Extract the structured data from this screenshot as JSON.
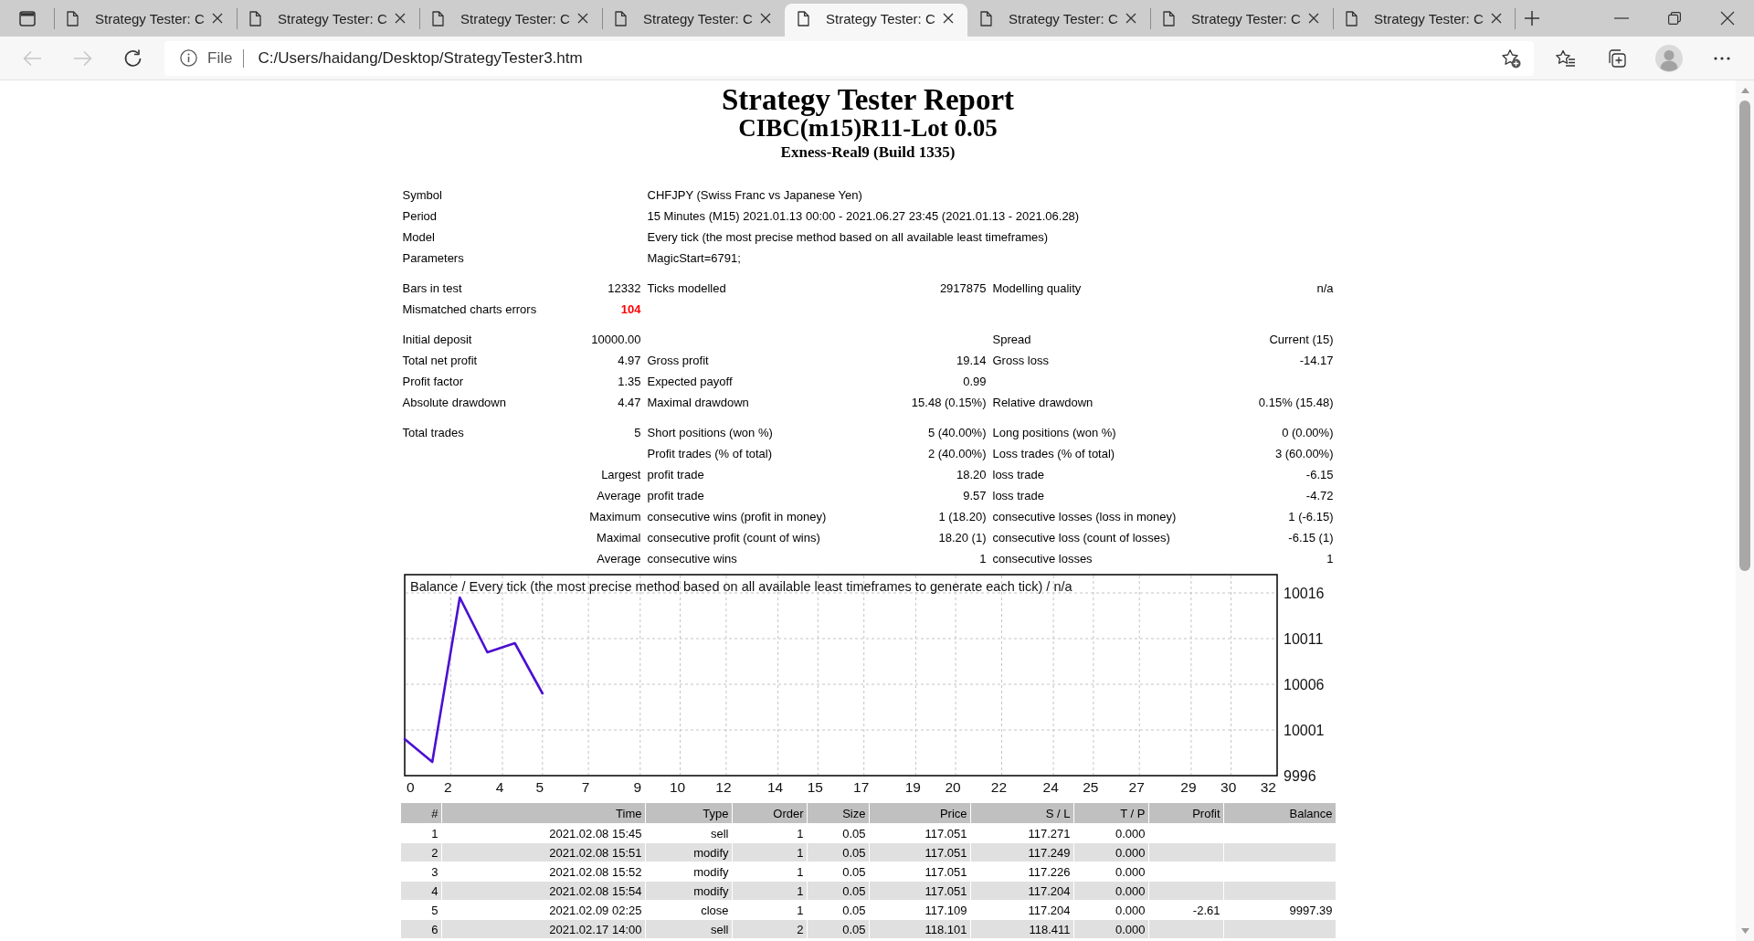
{
  "browser": {
    "tabs": [
      {
        "title": "Strategy Tester: C",
        "selected": false
      },
      {
        "title": "Strategy Tester: C",
        "selected": false
      },
      {
        "title": "Strategy Tester: C",
        "selected": false
      },
      {
        "title": "Strategy Tester: C",
        "selected": false
      },
      {
        "title": "Strategy Tester: C",
        "selected": true
      },
      {
        "title": "Strategy Tester: C",
        "selected": false
      },
      {
        "title": "Strategy Tester: C",
        "selected": false
      },
      {
        "title": "Strategy Tester: C",
        "selected": false
      }
    ],
    "nav_buttons": [
      {
        "kind": "back",
        "disabled": true
      },
      {
        "kind": "forward",
        "disabled": true
      },
      {
        "kind": "refresh",
        "disabled": false
      }
    ],
    "address": {
      "scheme": "File",
      "url": "C:/Users/haidang/Desktop/StrategyTester3.htm"
    }
  },
  "report": {
    "title": "Strategy Tester Report",
    "subtitle": "CIBC(m15)R11-Lot 0.05",
    "server": "Exness-Real9 (Build 1335)"
  },
  "summary": [
    {
      "rows": [
        {
          "kind": "info",
          "cells": [
            "Symbol",
            "CHFJPY (Swiss Franc vs Japanese Yen)"
          ]
        },
        {
          "kind": "info",
          "cells": [
            "Period",
            "15 Minutes (M15) 2021.01.13 00:00 - 2021.06.27 23:45 (2021.01.13 - 2021.06.28)"
          ]
        },
        {
          "kind": "info",
          "cells": [
            "Model",
            "Every tick (the most precise method based on all available least timeframes)"
          ]
        },
        {
          "kind": "info",
          "cells": [
            "Parameters",
            "MagicStart=6791;"
          ]
        }
      ]
    },
    {
      "rows": [
        {
          "kind": "stats",
          "cells": [
            "Bars in test",
            "12332",
            "Ticks modelled",
            "2917875",
            "Modelling quality",
            "n/a"
          ]
        },
        {
          "kind": "alert",
          "cells": [
            "Mismatched charts errors",
            "104"
          ]
        }
      ]
    },
    {
      "rows": [
        {
          "kind": "stats",
          "cells": [
            "Initial deposit",
            "10000.00",
            null,
            null,
            "Spread",
            "Current (15)"
          ]
        },
        {
          "kind": "stats",
          "cells": [
            "Total net profit",
            "4.97",
            "Gross profit",
            "19.14",
            "Gross loss",
            "-14.17"
          ]
        },
        {
          "kind": "stats",
          "cells": [
            "Profit factor",
            "1.35",
            "Expected payoff",
            "0.99",
            null,
            null
          ]
        },
        {
          "kind": "stats",
          "cells": [
            "Absolute drawdown",
            "4.47",
            "Maximal drawdown",
            "15.48 (0.15%)",
            "Relative drawdown",
            "0.15% (15.48)"
          ]
        }
      ]
    },
    {
      "rows": [
        {
          "kind": "stats",
          "cells": [
            "Total trades",
            "5",
            "Short positions (won %)",
            "5 (40.00%)",
            "Long positions (won %)",
            "0 (0.00%)"
          ]
        },
        {
          "kind": "stats",
          "cells": [
            null,
            null,
            "Profit trades (% of total)",
            "2 (40.00%)",
            "Loss trades (% of total)",
            "3 (60.00%)"
          ]
        },
        {
          "kind": "stats",
          "cells": [
            null,
            "Largest",
            "profit trade",
            "18.20",
            "loss trade",
            "-6.15"
          ]
        },
        {
          "kind": "stats",
          "cells": [
            null,
            "Average",
            "profit trade",
            "9.57",
            "loss trade",
            "-4.72"
          ]
        },
        {
          "kind": "stats",
          "cells": [
            null,
            "Maximum",
            "consecutive wins (profit in money)",
            "1 (18.20)",
            "consecutive losses (loss in money)",
            "1 (-6.15)"
          ]
        },
        {
          "kind": "stats",
          "cells": [
            null,
            "Maximal",
            "consecutive profit (count of wins)",
            "18.20 (1)",
            "consecutive loss (count of losses)",
            "-6.15 (1)"
          ]
        },
        {
          "kind": "stats",
          "cells": [
            null,
            "Average",
            "consecutive wins",
            "1",
            "consecutive losses",
            "1"
          ]
        }
      ]
    }
  ],
  "balance_chart": {
    "chart_data": {
      "type": "line",
      "title": "Balance / Every tick (the most precise method based on all available least timeframes to generate each tick) / n/a",
      "x": [
        0,
        1,
        2,
        3,
        4,
        5
      ],
      "values": [
        10000,
        9997.5,
        10015.5,
        10009.5,
        10010.5,
        10005
      ],
      "color": "#4b10d0",
      "xlim": [
        0,
        31.67
      ],
      "ylim": [
        9996,
        10018
      ],
      "xticks": [
        {
          "value": 0,
          "label": "0"
        },
        {
          "value": 1.67,
          "label": "2"
        },
        {
          "value": 3.55,
          "label": "4"
        },
        {
          "value": 5,
          "label": "5"
        },
        {
          "value": 6.67,
          "label": "7"
        },
        {
          "value": 8.55,
          "label": "9"
        },
        {
          "value": 10,
          "label": "10"
        },
        {
          "value": 11.67,
          "label": "12"
        },
        {
          "value": 13.55,
          "label": "14"
        },
        {
          "value": 15,
          "label": "15"
        },
        {
          "value": 16.67,
          "label": "17"
        },
        {
          "value": 18.55,
          "label": "19"
        },
        {
          "value": 20,
          "label": "20"
        },
        {
          "value": 21.67,
          "label": "22"
        },
        {
          "value": 23.55,
          "label": "24"
        },
        {
          "value": 25,
          "label": "25"
        },
        {
          "value": 26.67,
          "label": "27"
        },
        {
          "value": 28.55,
          "label": "29"
        },
        {
          "value": 30,
          "label": "30"
        },
        {
          "value": 31.67,
          "label": "32"
        }
      ],
      "yticks": [
        9996,
        10001,
        10006,
        10011,
        10016
      ],
      "grid": true
    }
  },
  "trades": {
    "columns": [
      "#",
      "Time",
      "Type",
      "Order",
      "Size",
      "Price",
      "S / L",
      "T / P",
      "Profit",
      "Balance"
    ],
    "rows": [
      [
        "1",
        "2021.02.08 15:45",
        "sell",
        "1",
        "0.05",
        "117.051",
        "117.271",
        "0.000",
        null,
        null
      ],
      [
        "2",
        "2021.02.08 15:51",
        "modify",
        "1",
        "0.05",
        "117.051",
        "117.249",
        "0.000",
        null,
        null
      ],
      [
        "3",
        "2021.02.08 15:52",
        "modify",
        "1",
        "0.05",
        "117.051",
        "117.226",
        "0.000",
        null,
        null
      ],
      [
        "4",
        "2021.02.08 15:54",
        "modify",
        "1",
        "0.05",
        "117.051",
        "117.204",
        "0.000",
        null,
        null
      ],
      [
        "5",
        "2021.02.09 02:25",
        "close",
        "1",
        "0.05",
        "117.109",
        "117.204",
        "0.000",
        "-2.61",
        "9997.39"
      ],
      [
        "6",
        "2021.02.17 14:00",
        "sell",
        "2",
        "0.05",
        "118.101",
        "118.411",
        "0.000",
        null,
        null
      ]
    ]
  }
}
